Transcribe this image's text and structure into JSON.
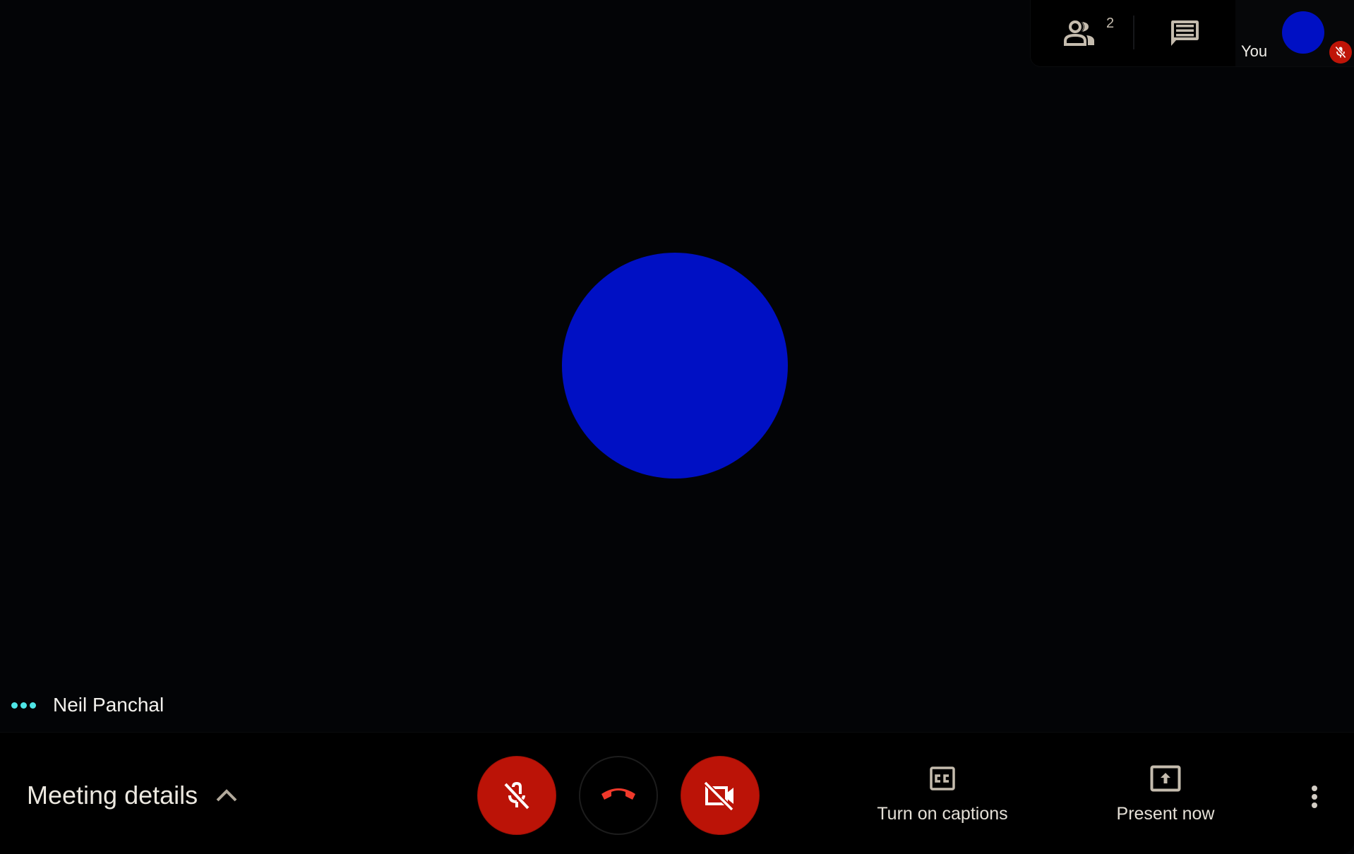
{
  "app": {
    "type": "video-meeting"
  },
  "colors": {
    "background": "#030406",
    "avatar": "#0010c4",
    "muted_red": "#bb1307",
    "hangup_red": "#f0392b",
    "speaking_dots": "#4ee6e6",
    "icon_beige": "#c5bcae",
    "text_light": "#ece8e0"
  },
  "main_stage": {
    "participant_name": "Neil Panchal",
    "avatar_icon": "participant-avatar",
    "speaking_indicator": "three-dots-icon"
  },
  "top_panel": {
    "people_button": {
      "icon": "people-icon",
      "count": "2"
    },
    "chat_button": {
      "icon": "chat-icon"
    },
    "self_view": {
      "label": "You",
      "avatar_icon": "self-avatar",
      "mic_status_icon": "mic-off-icon"
    }
  },
  "bottom_bar": {
    "meeting_details_label": "Meeting details",
    "meeting_details_icon": "chevron-up-icon",
    "mic_button": {
      "icon": "mic-off-icon",
      "state": "muted"
    },
    "hangup_button": {
      "icon": "hang-up-icon"
    },
    "camera_button": {
      "icon": "camera-off-icon",
      "state": "off"
    },
    "captions_button": {
      "icon": "closed-captions-icon",
      "label": "Turn on captions"
    },
    "present_button": {
      "icon": "present-screen-icon",
      "label": "Present now"
    },
    "more_button": {
      "icon": "more-vert-icon"
    }
  }
}
